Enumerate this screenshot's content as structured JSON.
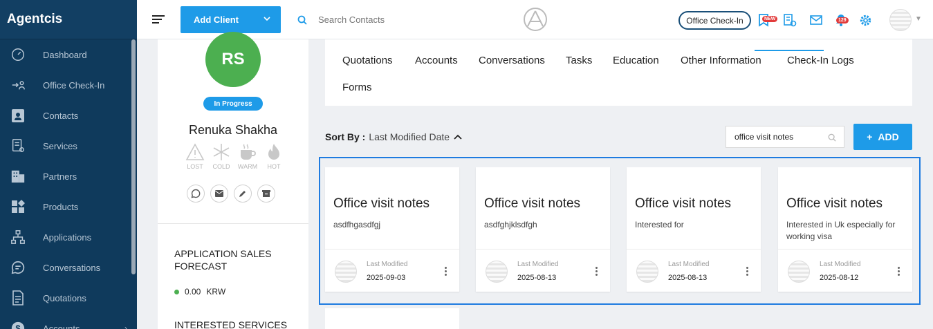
{
  "sidebar": {
    "brand": "Agentcis",
    "items": [
      {
        "label": "Dashboard",
        "icon": "gauge-icon"
      },
      {
        "label": "Office Check-In",
        "icon": "checkin-icon"
      },
      {
        "label": "Contacts",
        "icon": "contact-card-icon"
      },
      {
        "label": "Services",
        "icon": "services-icon"
      },
      {
        "label": "Partners",
        "icon": "building-icon"
      },
      {
        "label": "Products",
        "icon": "products-icon"
      },
      {
        "label": "Applications",
        "icon": "flow-icon"
      },
      {
        "label": "Conversations",
        "icon": "chat-icon"
      },
      {
        "label": "Quotations",
        "icon": "document-icon"
      },
      {
        "label": "Accounts",
        "icon": "dollar-icon"
      }
    ]
  },
  "topbar": {
    "add_client_label": "Add Client",
    "search_placeholder": "Search Contacts",
    "office_checkin_label": "Office Check-In",
    "new_badge": "NEW",
    "notification_count": "129"
  },
  "profile": {
    "initials": "RS",
    "status": "In Progress",
    "name": "Renuka Shakha",
    "temperatures": [
      "LOST",
      "COLD",
      "WARM",
      "HOT"
    ],
    "forecast_title": "APPLICATION SALES FORECAST",
    "forecast_value": "0.00",
    "forecast_currency": "KRW",
    "services_title": "INTERESTED SERVICES"
  },
  "tabs": [
    "Quotations",
    "Accounts",
    "Conversations",
    "Tasks",
    "Education",
    "Other Information",
    "Check-In Logs",
    "Forms"
  ],
  "active_tab": "Check-In Logs",
  "toolbar": {
    "sort_by_label": "Sort By :",
    "sort_value": "Last Modified Date",
    "filter_value": "office visit notes",
    "add_label": "ADD"
  },
  "cards": [
    {
      "title": "Office visit notes",
      "desc": "asdfhgasdfgj",
      "last_modified_label": "Last Modified",
      "date": "2025-09-03"
    },
    {
      "title": "Office visit notes",
      "desc": "asdfghjklsdfgh",
      "last_modified_label": "Last Modified",
      "date": "2025-08-13"
    },
    {
      "title": "Office visit notes",
      "desc": "Interested for",
      "last_modified_label": "Last Modified",
      "date": "2025-08-13"
    },
    {
      "title": "Office visit notes",
      "desc": "Interested in Uk especially for working visa",
      "last_modified_label": "Last Modified",
      "date": "2025-08-12"
    }
  ],
  "colors": {
    "sidebar": "#0f3a5c",
    "accent": "#1e9be8",
    "avatar": "#4caf50",
    "highlight": "#1e7be0"
  }
}
